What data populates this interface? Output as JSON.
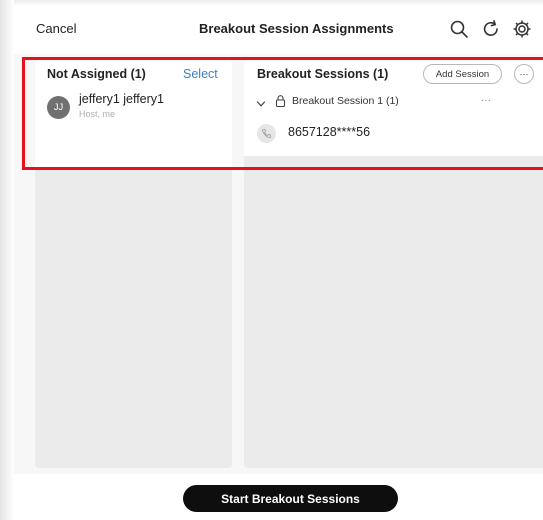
{
  "header": {
    "cancel_label": "Cancel",
    "title": "Breakout Session Assignments",
    "icons": [
      "search-icon",
      "refresh-icon",
      "settings-icon"
    ]
  },
  "not_assigned": {
    "title": "Not Assigned (1)",
    "select_label": "Select",
    "participants": [
      {
        "initials": "JJ",
        "name": "jeffery1 jeffery1",
        "role": "Host, me"
      }
    ]
  },
  "breakout_sessions": {
    "title": "Breakout Sessions (1)",
    "add_session_label": "Add Session",
    "more_label": "···",
    "sessions": [
      {
        "name": "Breakout Session 1 (1)",
        "more_label": "···",
        "members": [
          {
            "phone": "8657128****56"
          }
        ]
      }
    ]
  },
  "footer": {
    "start_label": "Start Breakout Sessions"
  },
  "colors": {
    "accent_link": "#3a83c9",
    "highlight_border": "#e8101a",
    "primary_button": "#0e0e0e"
  }
}
